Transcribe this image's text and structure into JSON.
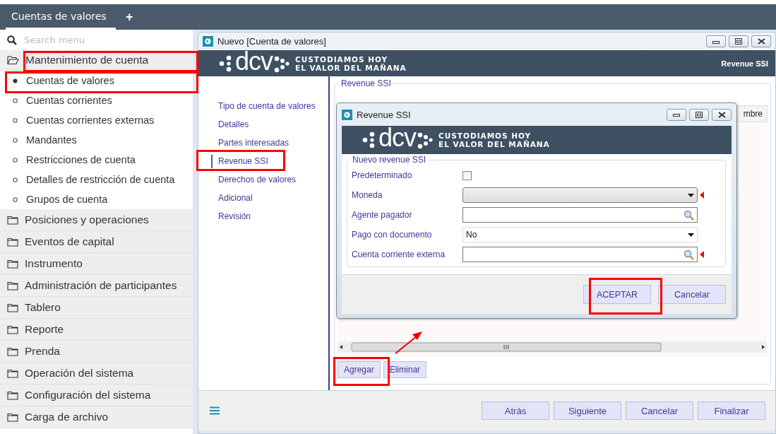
{
  "top_bar": {
    "tabs": [
      {
        "label": "Cuentas de valores",
        "selected": true
      }
    ],
    "add_tab": "+"
  },
  "sidebar": {
    "search": {
      "placeholder": "Search menu"
    },
    "sections": [
      {
        "label": "Mantenimiento de cuenta",
        "expanded": true,
        "children": [
          {
            "label": "Cuentas de valores",
            "selected": true
          },
          {
            "label": "Cuentas corrientes",
            "selected": false
          },
          {
            "label": "Cuentas corrientes externas",
            "selected": false
          },
          {
            "label": "Mandantes",
            "selected": false
          },
          {
            "label": "Restricciones de cuenta",
            "selected": false
          },
          {
            "label": "Detalles de restricción de cuenta",
            "selected": false
          },
          {
            "label": "Grupos de cuenta",
            "selected": false
          }
        ]
      },
      {
        "label": "Posiciones y operaciones",
        "expanded": false
      },
      {
        "label": "Eventos de capital",
        "expanded": false
      },
      {
        "label": "Instrumento",
        "expanded": false
      },
      {
        "label": "Administración de participantes",
        "expanded": false
      },
      {
        "label": "Tablero",
        "expanded": false
      },
      {
        "label": "Reporte",
        "expanded": false
      },
      {
        "label": "Prenda",
        "expanded": false
      },
      {
        "label": "Operación del sistema",
        "expanded": false
      },
      {
        "label": "Configuración del sistema",
        "expanded": false
      },
      {
        "label": "Carga de archivo",
        "expanded": false
      }
    ]
  },
  "window": {
    "title": "Nuevo [Cuenta de valores]",
    "banner": {
      "logo": "dcv",
      "slogan": [
        "CUSTODIAMOS HOY",
        "EL VALOR DEL MAÑANA"
      ],
      "page": "Revenue SSI"
    },
    "steps": [
      {
        "label": "Tipo de cuenta de valores",
        "selected": false
      },
      {
        "label": "Detalles",
        "selected": false
      },
      {
        "label": "Partes interesadas",
        "selected": false
      },
      {
        "label": "Revenue SSI",
        "selected": true
      },
      {
        "label": "Derechos de valores",
        "selected": false
      },
      {
        "label": "Adicional",
        "selected": false
      },
      {
        "label": "Revisión",
        "selected": false
      }
    ],
    "panel": {
      "legend": "Revenue SSI",
      "column_header": "mbre",
      "buttons": [
        "Agregar",
        "Eliminar"
      ]
    },
    "footer_buttons": [
      "Atrás",
      "Siguiente",
      "Cancelar",
      "Finalizar"
    ]
  },
  "dialog": {
    "title": "Revenue SSI",
    "banner": {
      "logo": "dcv",
      "slogan": [
        "CUSTODIAMOS HOY",
        "EL VALOR DEL MAÑANA"
      ]
    },
    "legend": "Nuevo revenue SSI",
    "fields": [
      {
        "kind": "checkbox",
        "label": "Predeterminado",
        "checked": false
      },
      {
        "kind": "select",
        "label": "Moneda",
        "required": true
      },
      {
        "kind": "lookup",
        "label": "Agente pagador",
        "required": false
      },
      {
        "kind": "select",
        "label": "Pago con documento",
        "value": "No",
        "required": false
      },
      {
        "kind": "lookup",
        "label": "Cuenta corriente externa",
        "required": true
      }
    ],
    "buttons": [
      "ACEPTAR",
      "Cancelar"
    ]
  }
}
